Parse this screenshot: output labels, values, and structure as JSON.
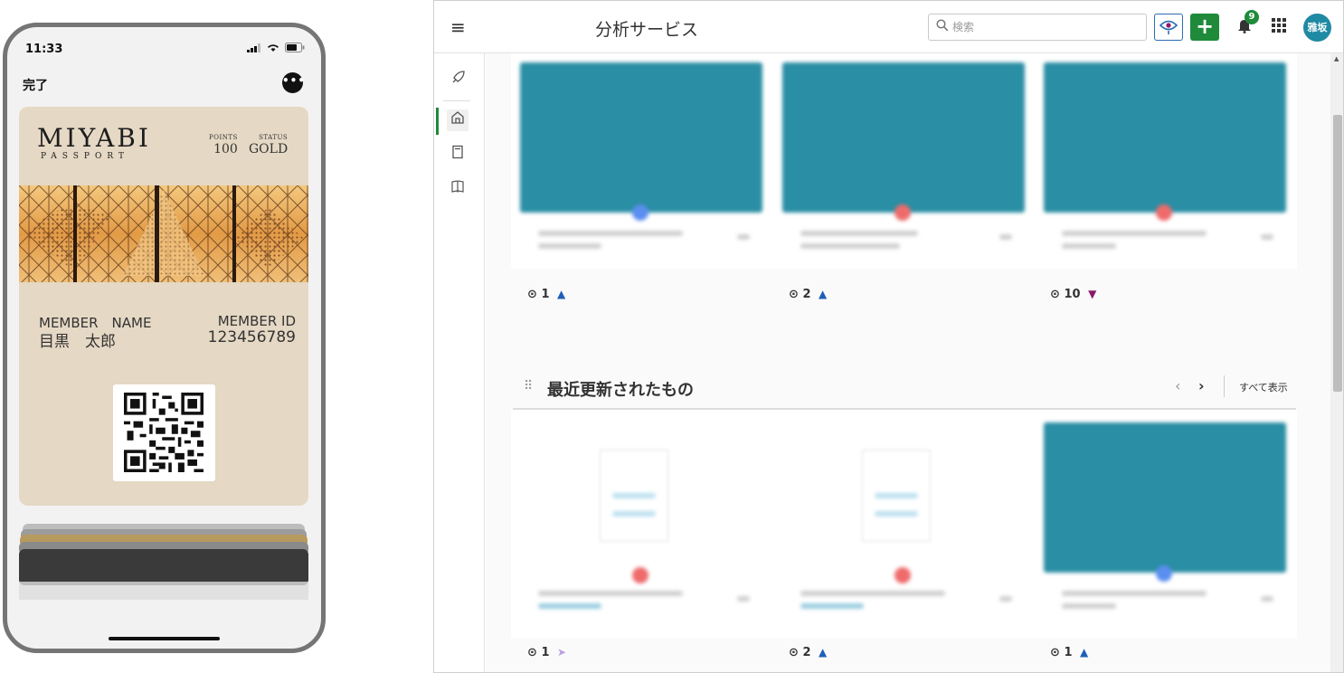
{
  "phone": {
    "status_time": "11:33",
    "done_label": "完了",
    "more_label": "•••",
    "pass": {
      "logo": "MIYABI",
      "logo_sub": "PASSPORT",
      "points_label": "POINTS",
      "points_value": "100",
      "status_label": "STATUS",
      "status_value": "GOLD",
      "member_name_label": "MEMBER　NAME",
      "member_name_value": "目黒　太郎",
      "member_id_label": "MEMBER ID",
      "member_id_value": "123456789"
    }
  },
  "app": {
    "title": "分析サービス",
    "menu_icon": "≡",
    "search": {
      "placeholder": "検索",
      "value": ""
    },
    "add_label": "+",
    "notification_count": "9",
    "avatar_label": "雅坂",
    "colors": {
      "accent": "#1e8a3a",
      "thumb": "#2a8ea4",
      "avatar": "#1f8aa3"
    },
    "sidebar_icons": [
      "rocket-icon",
      "home-icon",
      "notebook-icon",
      "book-icon"
    ],
    "top_cards": [
      {
        "views": "1",
        "trend": "up",
        "trend_glyph": "▲",
        "trend_color": "#1f5fb8",
        "dot_color": "#5b8ef0"
      },
      {
        "views": "2",
        "trend": "up",
        "trend_glyph": "▲",
        "trend_color": "#1f5fb8",
        "dot_color": "#ef6b6b"
      },
      {
        "views": "10",
        "trend": "down",
        "trend_glyph": "▼",
        "trend_color": "#8b1a6b",
        "dot_color": "#ef6b6b"
      }
    ],
    "recent_section": {
      "title": "最近更新されたもの",
      "show_all": "すべて表示",
      "cards": [
        {
          "views": "1",
          "trend": "flat",
          "trend_glyph": "➤",
          "trend_color": "#b9a0e0",
          "dot_color": "#ef6b6b"
        },
        {
          "views": "2",
          "trend": "up",
          "trend_glyph": "▲",
          "trend_color": "#1f5fb8",
          "dot_color": "#ef6b6b"
        },
        {
          "views": "1",
          "trend": "up",
          "trend_glyph": "▲",
          "trend_color": "#1f5fb8",
          "dot_color": "#5b8ef0"
        }
      ]
    }
  }
}
